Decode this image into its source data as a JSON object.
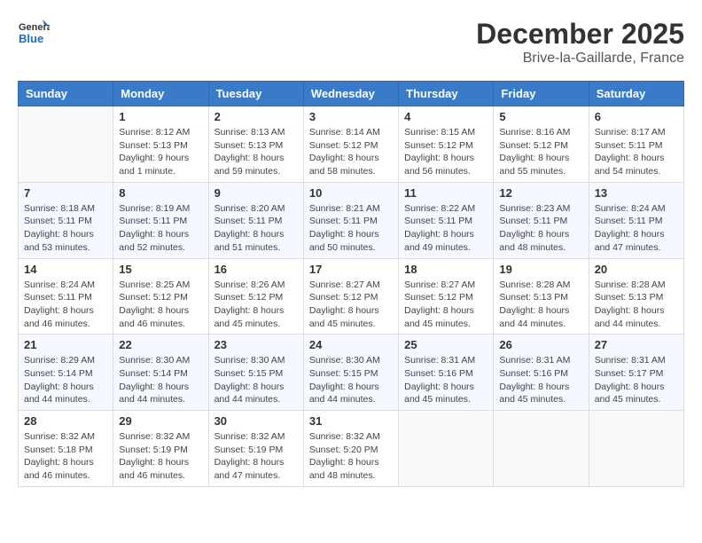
{
  "header": {
    "logo_line1": "General",
    "logo_line2": "Blue",
    "month": "December 2025",
    "location": "Brive-la-Gaillarde, France"
  },
  "weekdays": [
    "Sunday",
    "Monday",
    "Tuesday",
    "Wednesday",
    "Thursday",
    "Friday",
    "Saturday"
  ],
  "weeks": [
    [
      {
        "day": "",
        "info": ""
      },
      {
        "day": "1",
        "info": "Sunrise: 8:12 AM\nSunset: 5:13 PM\nDaylight: 9 hours\nand 1 minute."
      },
      {
        "day": "2",
        "info": "Sunrise: 8:13 AM\nSunset: 5:13 PM\nDaylight: 8 hours\nand 59 minutes."
      },
      {
        "day": "3",
        "info": "Sunrise: 8:14 AM\nSunset: 5:12 PM\nDaylight: 8 hours\nand 58 minutes."
      },
      {
        "day": "4",
        "info": "Sunrise: 8:15 AM\nSunset: 5:12 PM\nDaylight: 8 hours\nand 56 minutes."
      },
      {
        "day": "5",
        "info": "Sunrise: 8:16 AM\nSunset: 5:12 PM\nDaylight: 8 hours\nand 55 minutes."
      },
      {
        "day": "6",
        "info": "Sunrise: 8:17 AM\nSunset: 5:11 PM\nDaylight: 8 hours\nand 54 minutes."
      }
    ],
    [
      {
        "day": "7",
        "info": "Sunrise: 8:18 AM\nSunset: 5:11 PM\nDaylight: 8 hours\nand 53 minutes."
      },
      {
        "day": "8",
        "info": "Sunrise: 8:19 AM\nSunset: 5:11 PM\nDaylight: 8 hours\nand 52 minutes."
      },
      {
        "day": "9",
        "info": "Sunrise: 8:20 AM\nSunset: 5:11 PM\nDaylight: 8 hours\nand 51 minutes."
      },
      {
        "day": "10",
        "info": "Sunrise: 8:21 AM\nSunset: 5:11 PM\nDaylight: 8 hours\nand 50 minutes."
      },
      {
        "day": "11",
        "info": "Sunrise: 8:22 AM\nSunset: 5:11 PM\nDaylight: 8 hours\nand 49 minutes."
      },
      {
        "day": "12",
        "info": "Sunrise: 8:23 AM\nSunset: 5:11 PM\nDaylight: 8 hours\nand 48 minutes."
      },
      {
        "day": "13",
        "info": "Sunrise: 8:24 AM\nSunset: 5:11 PM\nDaylight: 8 hours\nand 47 minutes."
      }
    ],
    [
      {
        "day": "14",
        "info": "Sunrise: 8:24 AM\nSunset: 5:11 PM\nDaylight: 8 hours\nand 46 minutes."
      },
      {
        "day": "15",
        "info": "Sunrise: 8:25 AM\nSunset: 5:12 PM\nDaylight: 8 hours\nand 46 minutes."
      },
      {
        "day": "16",
        "info": "Sunrise: 8:26 AM\nSunset: 5:12 PM\nDaylight: 8 hours\nand 45 minutes."
      },
      {
        "day": "17",
        "info": "Sunrise: 8:27 AM\nSunset: 5:12 PM\nDaylight: 8 hours\nand 45 minutes."
      },
      {
        "day": "18",
        "info": "Sunrise: 8:27 AM\nSunset: 5:12 PM\nDaylight: 8 hours\nand 45 minutes."
      },
      {
        "day": "19",
        "info": "Sunrise: 8:28 AM\nSunset: 5:13 PM\nDaylight: 8 hours\nand 44 minutes."
      },
      {
        "day": "20",
        "info": "Sunrise: 8:28 AM\nSunset: 5:13 PM\nDaylight: 8 hours\nand 44 minutes."
      }
    ],
    [
      {
        "day": "21",
        "info": "Sunrise: 8:29 AM\nSunset: 5:14 PM\nDaylight: 8 hours\nand 44 minutes."
      },
      {
        "day": "22",
        "info": "Sunrise: 8:30 AM\nSunset: 5:14 PM\nDaylight: 8 hours\nand 44 minutes."
      },
      {
        "day": "23",
        "info": "Sunrise: 8:30 AM\nSunset: 5:15 PM\nDaylight: 8 hours\nand 44 minutes."
      },
      {
        "day": "24",
        "info": "Sunrise: 8:30 AM\nSunset: 5:15 PM\nDaylight: 8 hours\nand 44 minutes."
      },
      {
        "day": "25",
        "info": "Sunrise: 8:31 AM\nSunset: 5:16 PM\nDaylight: 8 hours\nand 45 minutes."
      },
      {
        "day": "26",
        "info": "Sunrise: 8:31 AM\nSunset: 5:16 PM\nDaylight: 8 hours\nand 45 minutes."
      },
      {
        "day": "27",
        "info": "Sunrise: 8:31 AM\nSunset: 5:17 PM\nDaylight: 8 hours\nand 45 minutes."
      }
    ],
    [
      {
        "day": "28",
        "info": "Sunrise: 8:32 AM\nSunset: 5:18 PM\nDaylight: 8 hours\nand 46 minutes."
      },
      {
        "day": "29",
        "info": "Sunrise: 8:32 AM\nSunset: 5:19 PM\nDaylight: 8 hours\nand 46 minutes."
      },
      {
        "day": "30",
        "info": "Sunrise: 8:32 AM\nSunset: 5:19 PM\nDaylight: 8 hours\nand 47 minutes."
      },
      {
        "day": "31",
        "info": "Sunrise: 8:32 AM\nSunset: 5:20 PM\nDaylight: 8 hours\nand 48 minutes."
      },
      {
        "day": "",
        "info": ""
      },
      {
        "day": "",
        "info": ""
      },
      {
        "day": "",
        "info": ""
      }
    ]
  ]
}
